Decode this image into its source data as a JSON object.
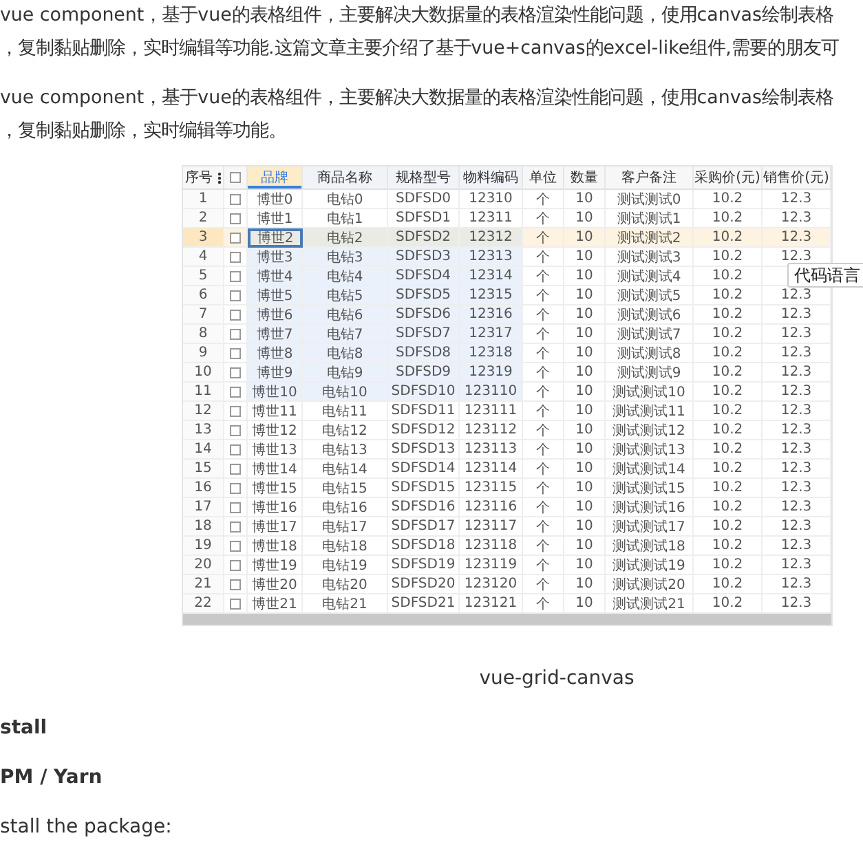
{
  "paragraphs": [
    {
      "lines": [
        "vue component，基于vue的表格组件，主要解决大数据量的表格渲染性能问题，使用canvas绘制表格",
        "，复制黏贴删除，实时编辑等功能.这篇文章主要介绍了基于vue+canvas的excel-like组件,需要的朋友可"
      ]
    },
    {
      "lines": [
        "vue component，基于vue的表格组件，主要解决大数据量的表格渲染性能问题，使用canvas绘制表格",
        "，复制黏贴删除，实时编辑等功能。"
      ]
    }
  ],
  "grid": {
    "index_label": "序号",
    "all_checked": false,
    "columns": [
      {
        "kind": "text",
        "label": "品牌",
        "selected": true,
        "in_range": true
      },
      {
        "kind": "text",
        "label": "商品名称",
        "selected": false,
        "in_range": true
      },
      {
        "kind": "text",
        "label": "规格型号",
        "selected": false,
        "in_range": true
      },
      {
        "kind": "text",
        "label": "物料编码",
        "selected": false,
        "in_range": true
      },
      {
        "kind": "text",
        "label": "单位",
        "selected": false,
        "in_range": false
      },
      {
        "kind": "text",
        "label": "数量",
        "selected": false,
        "in_range": false
      },
      {
        "kind": "text",
        "label": "客户备注",
        "selected": false,
        "in_range": false
      },
      {
        "kind": "text",
        "label": "采购价(元)",
        "selected": false,
        "in_range": false
      },
      {
        "kind": "text",
        "label": "销售价(元)",
        "selected": false,
        "in_range": false
      }
    ],
    "rows": [
      {
        "number": "1",
        "checked": false,
        "selected": false,
        "in_range": false,
        "cells": [
          "博世0",
          "电钻0",
          "SDFSD0",
          "12310",
          "个",
          "10",
          "测试测试0",
          "10.2",
          "12.3"
        ]
      },
      {
        "number": "2",
        "checked": false,
        "selected": false,
        "in_range": false,
        "cells": [
          "博世1",
          "电钻1",
          "SDFSD1",
          "12311",
          "个",
          "10",
          "测试测试1",
          "10.2",
          "12.3"
        ]
      },
      {
        "number": "3",
        "checked": false,
        "selected": true,
        "in_range": true,
        "cells": [
          "博世2",
          "电钻2",
          "SDFSD2",
          "12312",
          "个",
          "10",
          "测试测试2",
          "10.2",
          "12.3"
        ]
      },
      {
        "number": "4",
        "checked": false,
        "selected": false,
        "in_range": true,
        "cells": [
          "博世3",
          "电钻3",
          "SDFSD3",
          "12313",
          "个",
          "10",
          "测试测试3",
          "10.2",
          "12.3"
        ]
      },
      {
        "number": "5",
        "checked": false,
        "selected": false,
        "in_range": true,
        "cells": [
          "博世4",
          "电钻4",
          "SDFSD4",
          "12314",
          "个",
          "10",
          "测试测试4",
          "10.2"
        ]
      },
      {
        "number": "6",
        "checked": false,
        "selected": false,
        "in_range": true,
        "cells": [
          "博世5",
          "电钻5",
          "SDFSD5",
          "12315",
          "个",
          "10",
          "测试测试5",
          "10.2",
          "12.3"
        ]
      },
      {
        "number": "7",
        "checked": false,
        "selected": false,
        "in_range": true,
        "cells": [
          "博世6",
          "电钻6",
          "SDFSD6",
          "12316",
          "个",
          "10",
          "测试测试6",
          "10.2",
          "12.3"
        ]
      },
      {
        "number": "8",
        "checked": false,
        "selected": false,
        "in_range": true,
        "cells": [
          "博世7",
          "电钻7",
          "SDFSD7",
          "12317",
          "个",
          "10",
          "测试测试7",
          "10.2",
          "12.3"
        ]
      },
      {
        "number": "9",
        "checked": false,
        "selected": false,
        "in_range": true,
        "cells": [
          "博世8",
          "电钻8",
          "SDFSD8",
          "12318",
          "个",
          "10",
          "测试测试8",
          "10.2",
          "12.3"
        ]
      },
      {
        "number": "10",
        "checked": false,
        "selected": false,
        "in_range": true,
        "cells": [
          "博世9",
          "电钻9",
          "SDFSD9",
          "12319",
          "个",
          "10",
          "测试测试9",
          "10.2",
          "12.3"
        ]
      },
      {
        "number": "11",
        "checked": false,
        "selected": false,
        "in_range": true,
        "cells": [
          "博世10",
          "电钻10",
          "SDFSD10",
          "123110",
          "个",
          "10",
          "测试测试10",
          "10.2",
          "12.3"
        ]
      },
      {
        "number": "12",
        "checked": false,
        "selected": false,
        "in_range": false,
        "cells": [
          "博世11",
          "电钻11",
          "SDFSD11",
          "123111",
          "个",
          "10",
          "测试测试11",
          "10.2",
          "12.3"
        ]
      },
      {
        "number": "13",
        "checked": false,
        "selected": false,
        "in_range": false,
        "cells": [
          "博世12",
          "电钻12",
          "SDFSD12",
          "123112",
          "个",
          "10",
          "测试测试12",
          "10.2",
          "12.3"
        ]
      },
      {
        "number": "14",
        "checked": false,
        "selected": false,
        "in_range": false,
        "cells": [
          "博世13",
          "电钻13",
          "SDFSD13",
          "123113",
          "个",
          "10",
          "测试测试13",
          "10.2",
          "12.3"
        ]
      },
      {
        "number": "15",
        "checked": false,
        "selected": false,
        "in_range": false,
        "cells": [
          "博世14",
          "电钻14",
          "SDFSD14",
          "123114",
          "个",
          "10",
          "测试测试14",
          "10.2",
          "12.3"
        ]
      },
      {
        "number": "16",
        "checked": false,
        "selected": false,
        "in_range": false,
        "cells": [
          "博世15",
          "电钻15",
          "SDFSD15",
          "123115",
          "个",
          "10",
          "测试测试15",
          "10.2",
          "12.3"
        ]
      },
      {
        "number": "17",
        "checked": false,
        "selected": false,
        "in_range": false,
        "cells": [
          "博世16",
          "电钻16",
          "SDFSD16",
          "123116",
          "个",
          "10",
          "测试测试16",
          "10.2",
          "12.3"
        ]
      },
      {
        "number": "18",
        "checked": false,
        "selected": false,
        "in_range": false,
        "cells": [
          "博世17",
          "电钻17",
          "SDFSD17",
          "123117",
          "个",
          "10",
          "测试测试17",
          "10.2",
          "12.3"
        ]
      },
      {
        "number": "19",
        "checked": false,
        "selected": false,
        "in_range": false,
        "cells": [
          "博世18",
          "电钻18",
          "SDFSD18",
          "123118",
          "个",
          "10",
          "测试测试18",
          "10.2",
          "12.3"
        ]
      },
      {
        "number": "20",
        "checked": false,
        "selected": false,
        "in_range": false,
        "cells": [
          "博世19",
          "电钻19",
          "SDFSD19",
          "123119",
          "个",
          "10",
          "测试测试19",
          "10.2",
          "12.3"
        ]
      },
      {
        "number": "21",
        "checked": false,
        "selected": false,
        "in_range": false,
        "cells": [
          "博世20",
          "电钻20",
          "SDFSD20",
          "123120",
          "个",
          "10",
          "测试测试20",
          "10.2",
          "12.3"
        ]
      },
      {
        "number": "22",
        "checked": false,
        "selected": false,
        "in_range": false,
        "cells": [
          "博世21",
          "电钻21",
          "SDFSD21",
          "123121",
          "个",
          "10",
          "测试测试21",
          "10.2",
          "12.3"
        ]
      }
    ]
  },
  "tooltip": "代码语言",
  "caption": "vue-grid-canvas",
  "headings": [
    {
      "text": "stall"
    },
    {
      "text": "PM / Yarn"
    }
  ],
  "body": "stall the package:"
}
